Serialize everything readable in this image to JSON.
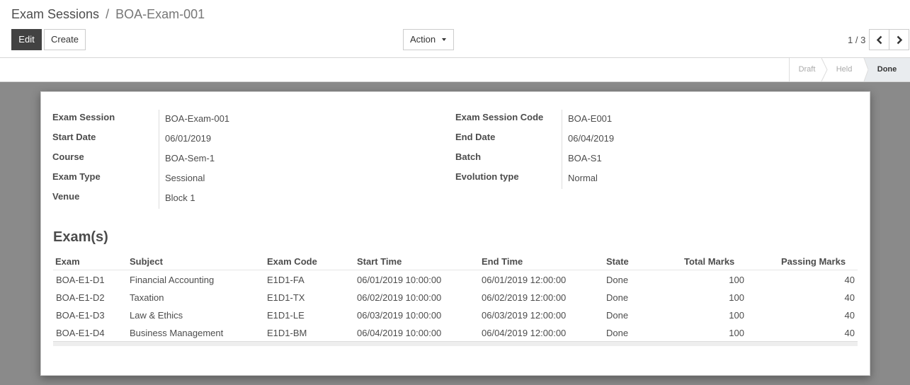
{
  "breadcrumb": {
    "parent": "Exam Sessions",
    "separator": "/",
    "current": "BOA-Exam-001"
  },
  "buttons": {
    "edit": "Edit",
    "create": "Create",
    "action": "Action"
  },
  "pager": {
    "value": "1 / 3"
  },
  "statusbar": {
    "stages": [
      "Draft",
      "Held",
      "Done"
    ],
    "active": "Done"
  },
  "form": {
    "left": [
      {
        "label": "Exam Session",
        "value": "BOA-Exam-001"
      },
      {
        "label": "Start Date",
        "value": "06/01/2019"
      },
      {
        "label": "Course",
        "value": "BOA-Sem-1"
      },
      {
        "label": "Exam Type",
        "value": "Sessional"
      },
      {
        "label": "Venue",
        "value": "Block 1"
      }
    ],
    "right": [
      {
        "label": "Exam Session Code",
        "value": "BOA-E001"
      },
      {
        "label": "End Date",
        "value": "06/04/2019"
      },
      {
        "label": "Batch",
        "value": "BOA-S1"
      },
      {
        "label": "Evolution type",
        "value": "Normal"
      }
    ]
  },
  "exams": {
    "title": "Exam(s)",
    "headers": [
      "Exam",
      "Subject",
      "Exam Code",
      "Start Time",
      "End Time",
      "State",
      "Total Marks",
      "Passing Marks"
    ],
    "rows": [
      [
        "BOA-E1-D1",
        "Financial Accounting",
        "E1D1-FA",
        "06/01/2019 10:00:00",
        "06/01/2019 12:00:00",
        "Done",
        "100",
        "40"
      ],
      [
        "BOA-E1-D2",
        "Taxation",
        "E1D1-TX",
        "06/02/2019 10:00:00",
        "06/02/2019 12:00:00",
        "Done",
        "100",
        "40"
      ],
      [
        "BOA-E1-D3",
        "Law & Ethics",
        "E1D1-LE",
        "06/03/2019 10:00:00",
        "06/03/2019 12:00:00",
        "Done",
        "100",
        "40"
      ],
      [
        "BOA-E1-D4",
        "Business Management",
        "E1D1-BM",
        "06/04/2019 10:00:00",
        "06/04/2019 12:00:00",
        "Done",
        "100",
        "40"
      ]
    ]
  },
  "icons": {
    "prev": "chevron-left-icon",
    "next": "chevron-right-icon",
    "caret": "caret-down-icon"
  }
}
